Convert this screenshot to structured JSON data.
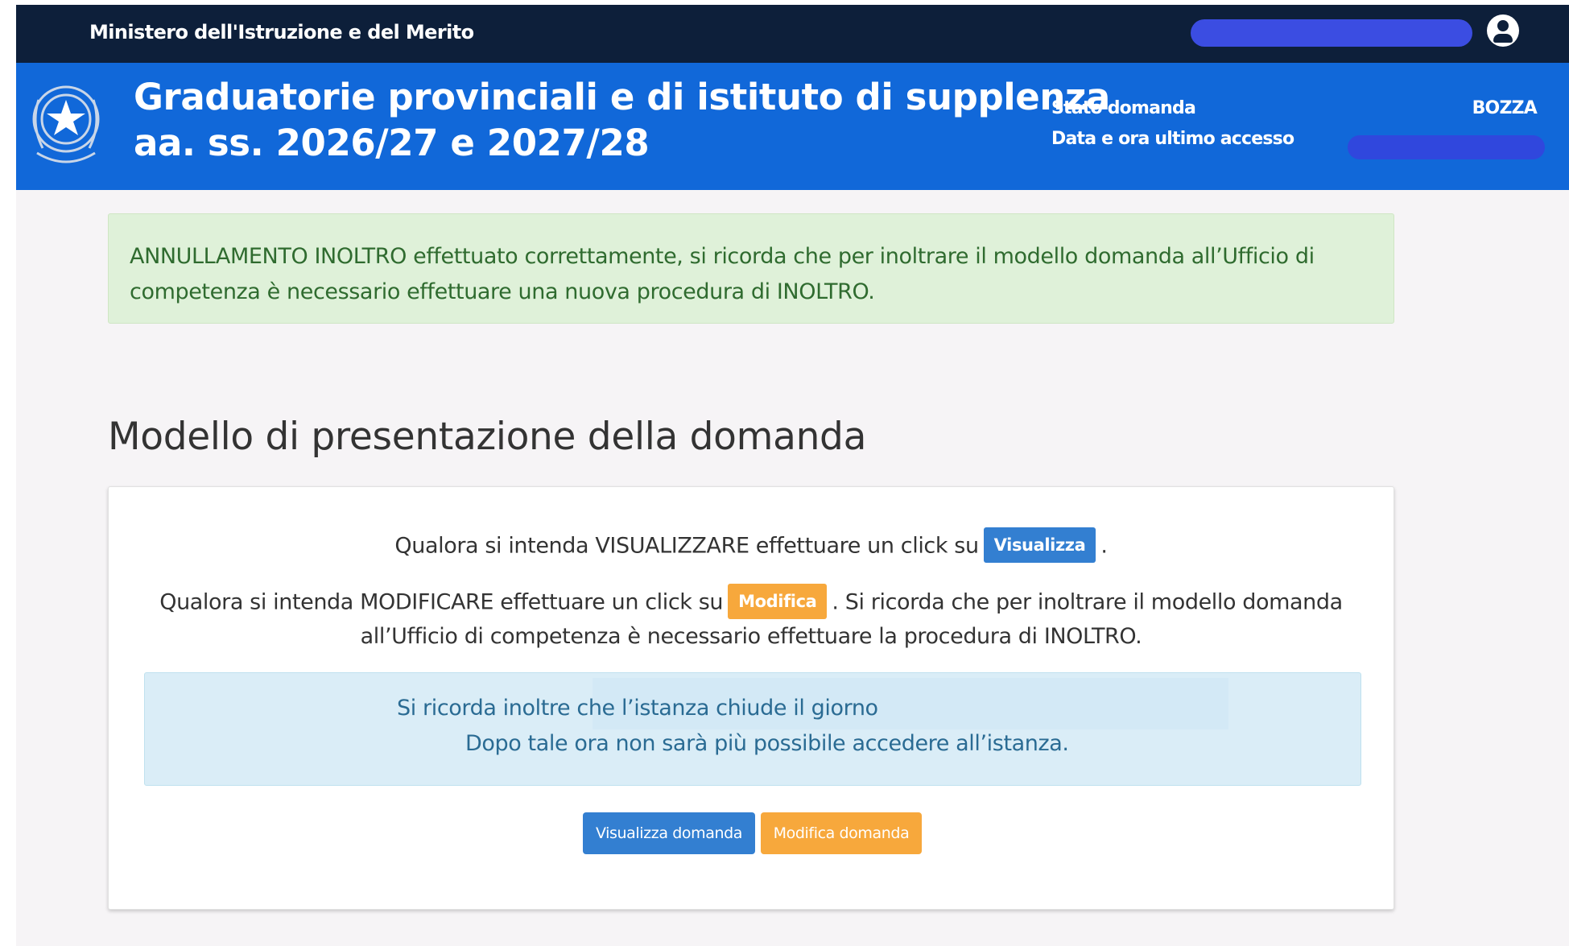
{
  "topbar": {
    "ministry": "Ministero dell'Istruzione e del Merito"
  },
  "header": {
    "title_line1": "Graduatorie provinciali e di istituto di supplenza",
    "title_line2": "aa. ss. 2026/27 e 2027/28",
    "status_label": "Stato domanda",
    "status_value": "BOZZA",
    "access_label": "Data e ora ultimo accesso"
  },
  "alert_success": {
    "line1": "ANNULLAMENTO INOLTRO effettuato correttamente, si ricorda che per inoltrare il modello domanda all’Ufficio di",
    "line2": "competenza è necessario effettuare una nuova procedura di INOLTRO."
  },
  "page": {
    "title": "Modello di presentazione della domanda"
  },
  "panel": {
    "view_text_before": "Qualora si intenda VISUALIZZARE effettuare un click su",
    "view_badge": "Visualizza",
    "view_text_after": ".",
    "edit_text_before": "Qualora si intenda MODIFICARE effettuare un click su",
    "edit_badge": "Modifica",
    "edit_text_after": ". Si ricorda che per inoltrare il modello domanda",
    "edit_line2": "all’Ufficio di competenza è necessario effettuare la procedura di INOLTRO.",
    "info_line1": "Si ricorda inoltre che l’istanza chiude il giorno",
    "info_line2": "Dopo tale ora non sarà più possibile accedere all’istanza.",
    "btn_view": "Visualizza domanda",
    "btn_edit": "Modifica domanda"
  },
  "colors": {
    "topbar": "#0d1f3a",
    "header": "#1168d9",
    "primary": "#337fd1",
    "warning": "#f7a83c",
    "success_bg": "#dff1d9",
    "info_bg": "#daedf7"
  },
  "icons": [
    "republic-emblem-icon",
    "user-circle-icon"
  ]
}
